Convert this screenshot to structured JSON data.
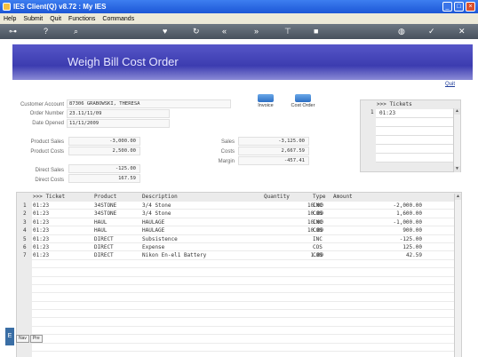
{
  "window": {
    "title": "IES Client(Q) v8.72 : My IES"
  },
  "menu": [
    "Help",
    "Submit",
    "Quit",
    "Functions",
    "Commands"
  ],
  "toolbar_icons": [
    "key-icon",
    "help-icon",
    "search-icon",
    "heart-icon",
    "refresh-icon",
    "rewind-icon",
    "fast-forward-icon",
    "pin-icon",
    "stop-icon",
    "globe-icon",
    "check-icon",
    "close-icon"
  ],
  "page": {
    "title": "Weigh Bill Cost Order",
    "quit_link": "Quit"
  },
  "form": {
    "customer_account_label": "Customer Account",
    "customer_account": "87306 GRABOWSKI, THERESA",
    "order_number_label": "Order Number",
    "order_number": "23.11/11/09",
    "date_opened_label": "Date Opened",
    "date_opened": "11/11/2009",
    "product_sales_label": "Product Sales",
    "product_sales": "-3,000.00",
    "product_costs_label": "Product Costs",
    "product_costs": "2,500.00",
    "direct_sales_label": "Direct Sales",
    "direct_sales": "-125.00",
    "direct_costs_label": "Direct Costs",
    "direct_costs": "167.59",
    "sales_label": "Sales",
    "sales": "-3,125.00",
    "costs_label": "Costs",
    "costs": "2,667.59",
    "margin_label": "Margin",
    "margin": "-457.41"
  },
  "actions": {
    "invoice": "Invoice",
    "cost_order": "Cost Order"
  },
  "tickets": {
    "header": ">>> Tickets",
    "rows": [
      {
        "num": "1",
        "ticket": "01:23"
      }
    ]
  },
  "grid": {
    "columns": {
      "ticket": ">>> Ticket",
      "product": "Product",
      "description": "Description",
      "quantity": "Quantity",
      "type": "Type",
      "amount": "Amount"
    },
    "rows": [
      {
        "num": "1",
        "ticket": "01:23",
        "product": "34STONE",
        "description": "3/4 Stone",
        "quantity": "10.00",
        "type": "INC",
        "amount": "-2,000.00"
      },
      {
        "num": "2",
        "ticket": "01:23",
        "product": "34STONE",
        "description": "3/4 Stone",
        "quantity": "10.00",
        "type": "COS",
        "amount": "1,600.00"
      },
      {
        "num": "3",
        "ticket": "01:23",
        "product": "HAUL",
        "description": "HAULAGE",
        "quantity": "10.00",
        "type": "INC",
        "amount": "-1,000.00"
      },
      {
        "num": "4",
        "ticket": "01:23",
        "product": "HAUL",
        "description": "HAULAGE",
        "quantity": "10.00",
        "type": "COS",
        "amount": "900.00"
      },
      {
        "num": "5",
        "ticket": "01:23",
        "product": "DIRECT",
        "description": "Subsistence",
        "quantity": "",
        "type": "INC",
        "amount": "-125.00"
      },
      {
        "num": "6",
        "ticket": "01:23",
        "product": "DIRECT",
        "description": "Expense",
        "quantity": "",
        "type": "COS",
        "amount": "125.00"
      },
      {
        "num": "7",
        "ticket": "01:23",
        "product": "DIRECT",
        "description": "Nikon En-el1 Battery",
        "quantity": "1.00",
        "type": "COS",
        "amount": "42.59"
      }
    ]
  },
  "bottom_tabs": [
    "Nav",
    "Pre"
  ],
  "side_tab": "E"
}
